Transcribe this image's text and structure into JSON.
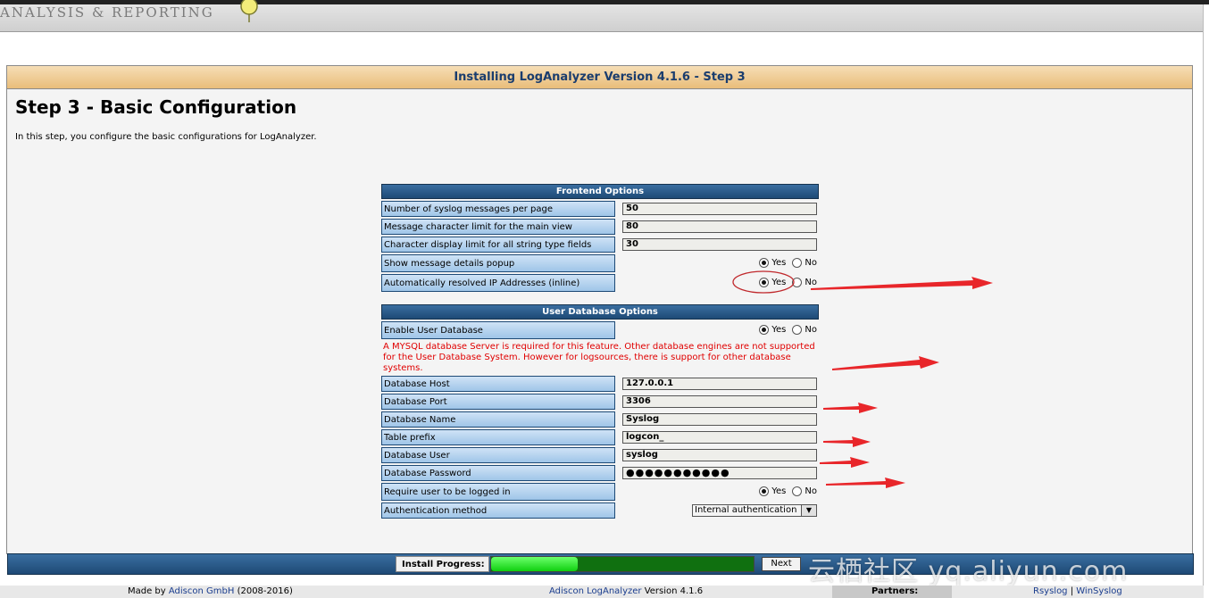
{
  "header": {
    "logo_text": "ANALYSIS & REPORTING"
  },
  "panel": {
    "title": "Installing LogAnalyzer Version 4.1.6 - Step 3",
    "step_title": "Step 3 - Basic Configuration",
    "step_desc": "In this step, you configure the basic configurations for LogAnalyzer."
  },
  "frontend": {
    "heading": "Frontend Options",
    "msgs_per_page": {
      "label": "Number of syslog messages per page",
      "value": "50"
    },
    "char_limit_main": {
      "label": "Message character limit for the main view",
      "value": "80"
    },
    "char_limit_string": {
      "label": "Character display limit for all string type fields",
      "value": "30"
    },
    "details_popup": {
      "label": "Show message details popup",
      "selected": "Yes"
    },
    "resolve_ip": {
      "label": "Automatically resolved IP Addresses (inline)",
      "selected": "Yes"
    }
  },
  "userdb": {
    "heading": "User Database Options",
    "enable": {
      "label": "Enable User Database",
      "selected": "Yes"
    },
    "warning": " A MYSQL database Server is required for this feature. Other database engines are not supported for the User Database System. However for logsources, there is support for other database systems.",
    "host": {
      "label": "Database Host",
      "value": "127.0.0.1"
    },
    "port": {
      "label": "Database Port",
      "value": "3306"
    },
    "name": {
      "label": "Database Name",
      "value": "Syslog"
    },
    "prefix": {
      "label": "Table prefix",
      "value": "logcon_"
    },
    "user": {
      "label": "Database User",
      "value": "syslog"
    },
    "password": {
      "label": "Database Password",
      "value": "●●●●●●●●●●●"
    },
    "require_login": {
      "label": "Require user to be logged in",
      "selected": "Yes"
    },
    "auth_method": {
      "label": "Authentication method",
      "value": "Internal authentication"
    }
  },
  "radio_labels": {
    "yes": "Yes",
    "no": "No"
  },
  "progress": {
    "label": "Install Progress:",
    "fraction": 0.33,
    "next_label": "Next"
  },
  "footer": {
    "made_by_prefix": "Made by ",
    "made_by_link": "Adiscon GmbH",
    "made_by_years": " (2008-2016)",
    "product_link": "Adiscon LogAnalyzer",
    "product_version": " Version 4.1.6",
    "partners_label": "Partners:",
    "partner1": "Rsyslog",
    "separator": " | ",
    "partner2": "WinSyslog"
  },
  "watermark": "云栖社区 yq.aliyun.com",
  "colors": {
    "annotation": "#e8262a",
    "accent": "#1e4a76",
    "progress": "#0fcf0f"
  }
}
